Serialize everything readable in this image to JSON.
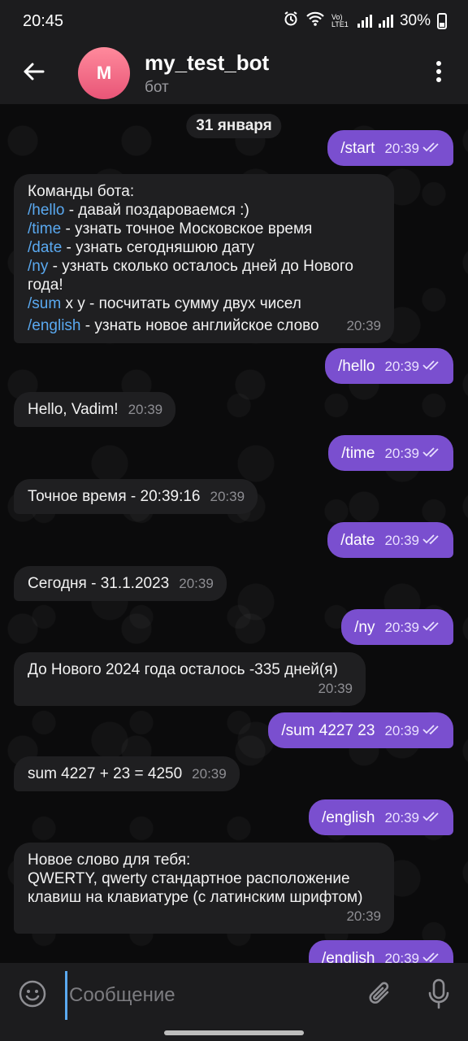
{
  "status": {
    "time": "20:45",
    "network_label": "Vo) LTE1",
    "battery": "30%"
  },
  "header": {
    "avatar_letter": "M",
    "name": "my_test_bot",
    "subtitle": "бот"
  },
  "chat": {
    "date": "31 января",
    "messages": [
      {
        "dir": "out",
        "text": "/start",
        "time": "20:39"
      },
      {
        "dir": "in",
        "lines": [
          {
            "text": "Команды бота:"
          },
          {
            "cmd": "/hello",
            "text": " - давай поздароваемся :)"
          },
          {
            "cmd": "/time",
            "text": " - узнать точное Московское время"
          },
          {
            "cmd": "/date",
            "text": " - узнать сегодняшюю дату"
          },
          {
            "cmd": "/ny",
            "text": " - узнать сколько осталось дней до Нового"
          },
          {
            "text": "года!"
          },
          {
            "cmd": "/sum",
            "text": " x y - посчитать сумму двух чисел"
          },
          {
            "cmd": "/english",
            "text": " - узнать новое английское слово"
          }
        ],
        "time": "20:39"
      },
      {
        "dir": "out",
        "text": "/hello",
        "time": "20:39"
      },
      {
        "dir": "in",
        "text": "Hello, Vadim!",
        "time": "20:39"
      },
      {
        "dir": "out",
        "text": "/time",
        "time": "20:39"
      },
      {
        "dir": "in",
        "text": "Точное время - 20:39:16",
        "time": "20:39"
      },
      {
        "dir": "out",
        "text": "/date",
        "time": "20:39"
      },
      {
        "dir": "in",
        "text": "Сегодня - 31.1.2023",
        "time": "20:39"
      },
      {
        "dir": "out",
        "text": "/ny",
        "time": "20:39"
      },
      {
        "dir": "in",
        "text": "До Нового 2024 года осталось -335 дней(я)",
        "time": "20:39"
      },
      {
        "dir": "out",
        "text": "/sum 4227 23",
        "time": "20:39"
      },
      {
        "dir": "in",
        "text": "sum 4227 + 23 = 4250",
        "time": "20:39"
      },
      {
        "dir": "out",
        "text": "/english",
        "time": "20:39"
      },
      {
        "dir": "in",
        "lines": [
          {
            "text": "Новое слово для тебя:"
          },
          {
            "text": "QWERTY, qwerty стандартное расположение"
          },
          {
            "text": "клавиш на клавиатуре (с латинским шрифтом)"
          }
        ],
        "time": "20:39"
      },
      {
        "dir": "out",
        "text": "/english",
        "time": "20:39"
      }
    ]
  },
  "composer": {
    "placeholder": "Сообщение"
  },
  "icons": [
    "back-arrow-icon",
    "more-vert-icon",
    "double-check-icon",
    "emoji-icon",
    "paperclip-icon",
    "microphone-icon",
    "alarm-icon",
    "wifi-icon",
    "signal-icon",
    "battery-icon"
  ],
  "colors": {
    "outgoing_bubble": "#7a4fcf",
    "incoming_bubble": "#1f1f21",
    "command_link": "#5aa9f0",
    "avatar": "#e85577"
  }
}
